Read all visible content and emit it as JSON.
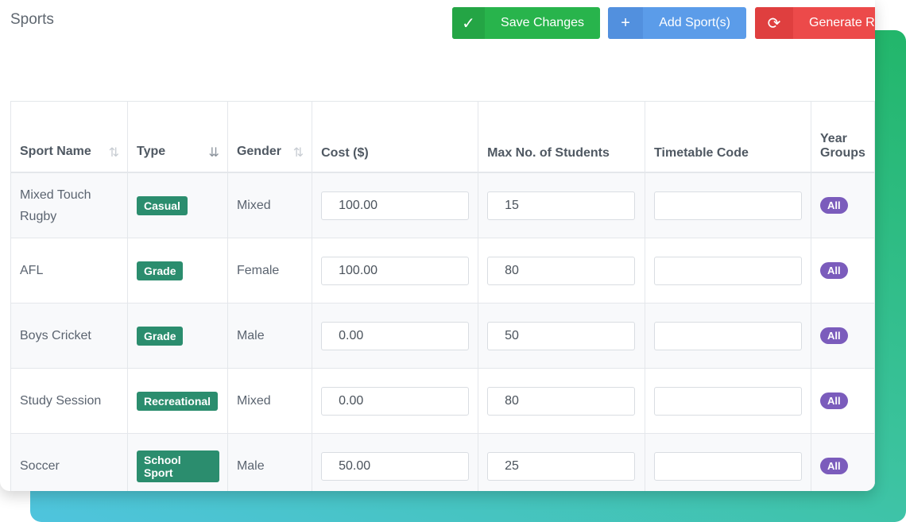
{
  "page": {
    "title": "Sports"
  },
  "toolbar": {
    "save_label": "Save Changes",
    "add_label": "Add Sport(s)",
    "generate_label": "Generate Ro"
  },
  "table": {
    "headers": {
      "sport_name": "Sport Name",
      "type": "Type",
      "gender": "Gender",
      "cost": "Cost ($)",
      "max_students": "Max No. of Students",
      "timetable_code": "Timetable Code",
      "year_groups_1": "Year",
      "year_groups_2": "Groups"
    },
    "rows": [
      {
        "name": "Mixed Touch Rugby",
        "type": "Casual",
        "gender": "Mixed",
        "cost": "100.00",
        "max": "15",
        "code": "",
        "years": "All"
      },
      {
        "name": "AFL",
        "type": "Grade",
        "gender": "Female",
        "cost": "100.00",
        "max": "80",
        "code": "",
        "years": "All"
      },
      {
        "name": "Boys Cricket",
        "type": "Grade",
        "gender": "Male",
        "cost": "0.00",
        "max": "50",
        "code": "",
        "years": "All"
      },
      {
        "name": "Study Session",
        "type": "Recreational",
        "gender": "Mixed",
        "cost": "0.00",
        "max": "80",
        "code": "",
        "years": "All"
      },
      {
        "name": "Soccer",
        "type": "School Sport",
        "gender": "Male",
        "cost": "50.00",
        "max": "25",
        "code": "",
        "years": "All"
      }
    ]
  },
  "colors": {
    "save": "#28b44c",
    "add": "#5b9ce9",
    "generate": "#ec4a4a",
    "type_badge": "#2b8d6e",
    "year_pill": "#7b5cbc"
  },
  "icons": {
    "save": "check-icon",
    "add": "plus-icon",
    "generate": "refresh-icon",
    "sort_inactive": "sort-icon",
    "sort_active": "sort-descending-icon"
  }
}
